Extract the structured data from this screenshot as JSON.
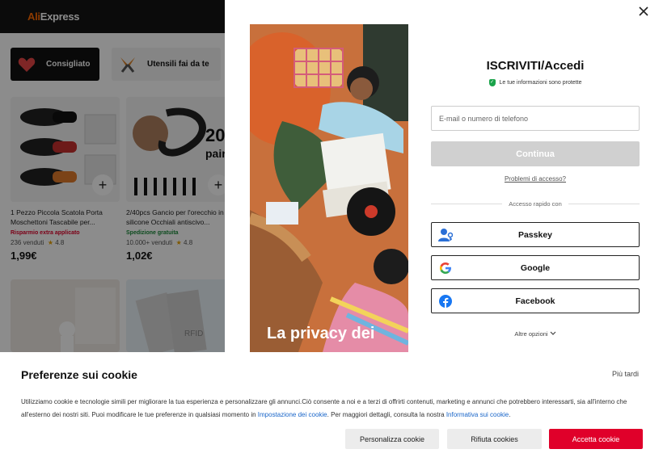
{
  "colors": {
    "accent": "#e0002a",
    "topbar": "#141414",
    "link": "#1a66c9",
    "secure": "#1aa34a",
    "disabled_button": "#d0d0d0"
  },
  "header": {
    "logo_prefix": "Ali",
    "logo_suffix": "Express"
  },
  "categories": [
    {
      "label": "Consigliato",
      "icon": "heart-icon"
    },
    {
      "label": "Utensili fai da te",
      "icon": "pliers-icon"
    }
  ],
  "products": [
    {
      "title": "1 Pezzo Piccola Scatola Porta Moschettoni Tascabile per...",
      "tag": "Risparmio extra applicato",
      "sold": "236 venduti",
      "rating": "4.8",
      "price": "1,99€"
    },
    {
      "title": "2/40pcs Gancio per l'orecchio in silicone Occhiali antiscivo...",
      "tag": "Spedizione gratuita",
      "sold": "10.000+ venduti",
      "rating": "4.8",
      "price": "1,02€"
    }
  ],
  "modal": {
    "close_icon": "close-icon",
    "promo_text": "La privacy dei",
    "title": "ISCRIVITI/Accedi",
    "secure_note": "Le tue informazioni sono protette",
    "email_placeholder": "E-mail o numero di telefono",
    "continue_label": "Continua",
    "problems_link": "Problemi di accesso?",
    "quick_access": "Accesso rapido con",
    "social": [
      {
        "label": "Passkey",
        "icon": "passkey-icon"
      },
      {
        "label": "Google",
        "icon": "google-icon"
      },
      {
        "label": "Facebook",
        "icon": "facebook-icon"
      }
    ],
    "more_options": "Altre opzioni"
  },
  "cookie": {
    "title": "Preferenze sui cookie",
    "later": "Più tardi",
    "text_1": "Utilizziamo cookie e tecnologie simili per migliorare la tua esperienza e personalizzare gli annunci.Ciò consente a noi e a terzi di offrirti contenuti, marketing e annunci che potrebbero interessarti, sia all'interno che all'esterno dei nostri siti. Puoi modificare le tue preferenze in qualsiasi momento in ",
    "link_settings": "Impostazione dei cookie",
    "text_2": ". Per maggiori dettagli, consulta la nostra ",
    "link_policy": "Informativa sui cookie",
    "text_3": ".",
    "btn_personalize": "Personalizza cookie",
    "btn_reject": "Rifiuta cookies",
    "btn_accept": "Accetta cookie"
  }
}
